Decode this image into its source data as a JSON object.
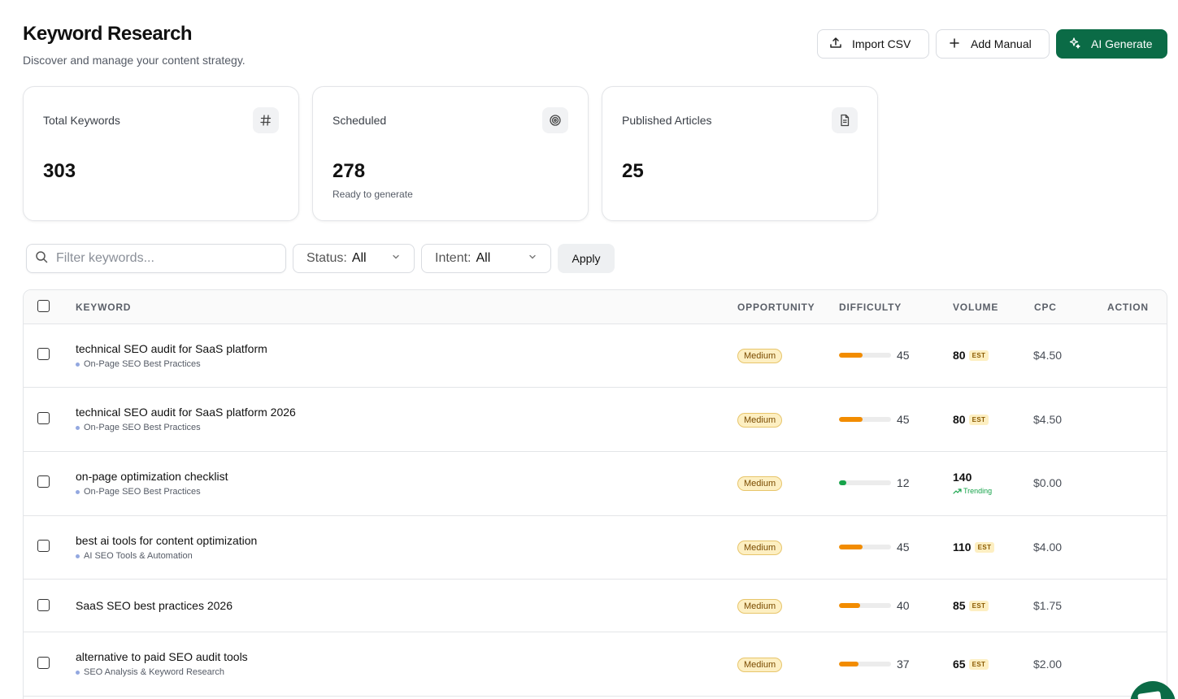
{
  "header": {
    "title": "Keyword Research",
    "subtitle": "Discover and manage your content strategy."
  },
  "actions": {
    "import_label": "Import CSV",
    "add_label": "Add Manual",
    "ai_label": "AI Generate"
  },
  "stats": [
    {
      "label": "Total Keywords",
      "value": "303",
      "note": "",
      "icon": "hash-icon"
    },
    {
      "label": "Scheduled",
      "value": "278",
      "note": "Ready to generate",
      "icon": "target-icon"
    },
    {
      "label": "Published Articles",
      "value": "25",
      "note": "",
      "icon": "document-icon"
    }
  ],
  "filters": {
    "search_placeholder": "Filter keywords...",
    "status_label": "Status:",
    "status_value": "All",
    "intent_label": "Intent:",
    "intent_value": "All",
    "apply_label": "Apply"
  },
  "table": {
    "columns": {
      "keyword": "KEYWORD",
      "opportunity": "OPPORTUNITY",
      "difficulty": "DIFFICULTY",
      "volume": "VOLUME",
      "cpc": "CPC",
      "action": "ACTION"
    },
    "rows": [
      {
        "keyword": "technical SEO audit for SaaS platform",
        "cluster": "On-Page SEO Best Practices",
        "opportunity": "Medium",
        "difficulty": 45,
        "volume": "80",
        "volume_tag": "EST",
        "trend": "",
        "cpc": "$4.50"
      },
      {
        "keyword": "technical SEO audit for SaaS platform 2026",
        "cluster": "On-Page SEO Best Practices",
        "opportunity": "Medium",
        "difficulty": 45,
        "volume": "80",
        "volume_tag": "EST",
        "trend": "",
        "cpc": "$4.50"
      },
      {
        "keyword": "on-page optimization checklist",
        "cluster": "On-Page SEO Best Practices",
        "opportunity": "Medium",
        "difficulty": 12,
        "volume": "140",
        "volume_tag": "",
        "trend": "Trending",
        "cpc": "$0.00"
      },
      {
        "keyword": "best ai tools for content optimization",
        "cluster": "AI SEO Tools & Automation",
        "opportunity": "Medium",
        "difficulty": 45,
        "volume": "110",
        "volume_tag": "EST",
        "trend": "",
        "cpc": "$4.00"
      },
      {
        "keyword": "SaaS SEO best practices 2026",
        "cluster": "",
        "opportunity": "Medium",
        "difficulty": 40,
        "volume": "85",
        "volume_tag": "EST",
        "trend": "",
        "cpc": "$1.75"
      },
      {
        "keyword": "alternative to paid SEO audit tools",
        "cluster": "SEO Analysis & Keyword Research",
        "opportunity": "Medium",
        "difficulty": 37,
        "volume": "65",
        "volume_tag": "EST",
        "trend": "",
        "cpc": "$2.00"
      }
    ]
  },
  "colors": {
    "primary": "#0b6b46",
    "difficulty_medium": "#f28c00",
    "difficulty_low": "#16a34a",
    "badge_bg": "#fdefc2"
  }
}
